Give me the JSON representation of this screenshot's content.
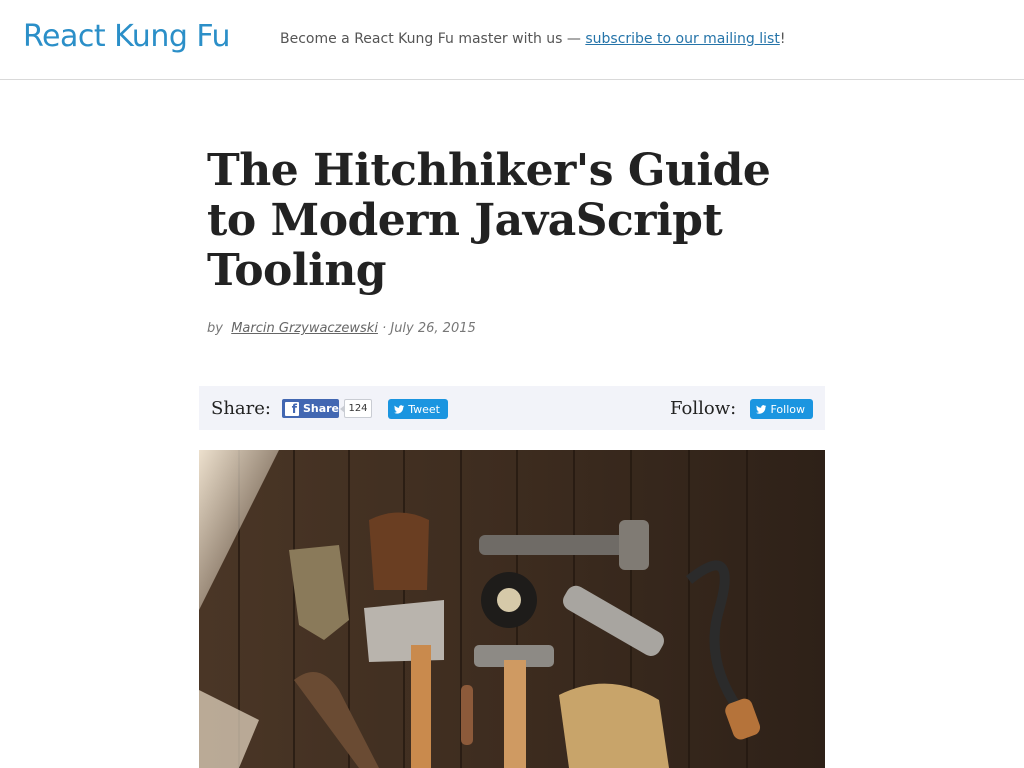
{
  "header": {
    "brand": "React Kung Fu",
    "tagline_prefix": "Become a React Kung Fu master with us — ",
    "tagline_link": "subscribe to our mailing list",
    "tagline_suffix": "!"
  },
  "article": {
    "title": "The Hitchhiker's Guide to Modern JavaScript Tooling",
    "byline_prefix": "by",
    "author": "Marcin Grzywaczewski",
    "separator": "·",
    "date": "July 26, 2015"
  },
  "share_bar": {
    "share_label": "Share:",
    "fb_share_label": "Share",
    "fb_share_count": "124",
    "tweet_label": "Tweet",
    "follow_label": "Follow:",
    "follow_button_label": "Follow"
  },
  "hero": {
    "icon": "tools-on-wooden-table-photo"
  },
  "colors": {
    "brand": "#2b8fc8",
    "link": "#2574a9",
    "facebook": "#4267b2",
    "twitter": "#1b95e0",
    "share_bar_bg": "#f2f3f9"
  }
}
